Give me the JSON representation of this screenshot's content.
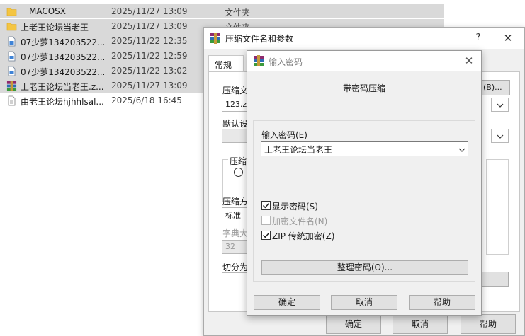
{
  "explorer": {
    "files": [
      {
        "name": "__MACOSX",
        "date": "2025/11/27 13:09",
        "type": "文件夹",
        "icon": "folder-icon",
        "selected": true
      },
      {
        "name": "上老王论坛当老王",
        "date": "2025/11/27 13:09",
        "type": "文件夹",
        "icon": "folder-icon",
        "selected": true
      },
      {
        "name": "07少萝134203522...",
        "date": "2025/11/22 12:35",
        "type": "",
        "icon": "image-file-icon",
        "selected": true
      },
      {
        "name": "07少萝134203522...",
        "date": "2025/11/22 12:59",
        "type": "",
        "icon": "image-file-icon",
        "selected": true
      },
      {
        "name": "07少萝134203522...",
        "date": "2025/11/22 13:02",
        "type": "",
        "icon": "image-file-icon",
        "selected": true
      },
      {
        "name": "上老王论坛当老王.z...",
        "date": "2025/11/27 13:09",
        "type": "",
        "icon": "winrar-archive-icon",
        "selected": true
      },
      {
        "name": "由老王论坛hjhhlsal...",
        "date": "2025/6/18 16:45",
        "type": "",
        "icon": "text-file-icon",
        "selected": false
      }
    ]
  },
  "archive_dialog": {
    "title": "压缩文件名和参数",
    "help_symbol": "?",
    "close_symbol": "✕",
    "tab_general": "常规",
    "archive_name_label": "压缩文",
    "archive_name_value": "123.zip",
    "browse_label": "(B)...",
    "default_profile_label": "默认设",
    "compression_group_label": "压缩",
    "method_label": "压缩方",
    "method_value": "标准",
    "dictionary_label": "字典大",
    "dictionary_value": "32",
    "split_label": "切分为",
    "ok_label": "确定",
    "cancel_label": "取消",
    "help_label": "帮助"
  },
  "password_dialog": {
    "title": "输入密码",
    "close_symbol": "✕",
    "heading": "带密码压缩",
    "enter_password_label": "输入密码(E)",
    "password_value": "上老王论坛当老王",
    "show_password_label": "显示密码(S)",
    "show_password_checked": true,
    "encrypt_filenames_label": "加密文件名(N)",
    "encrypt_filenames_checked": false,
    "zip_legacy_label": "ZIP 传统加密(Z)",
    "zip_legacy_checked": true,
    "organize_label": "整理密码(O)...",
    "ok_label": "确定",
    "cancel_label": "取消",
    "help_label": "帮助"
  },
  "colors": {
    "selection": "#d9d9d9",
    "folder": "#f4c542",
    "dialog_bg": "#f0f0f0",
    "button_bg": "#e1e1e1"
  }
}
